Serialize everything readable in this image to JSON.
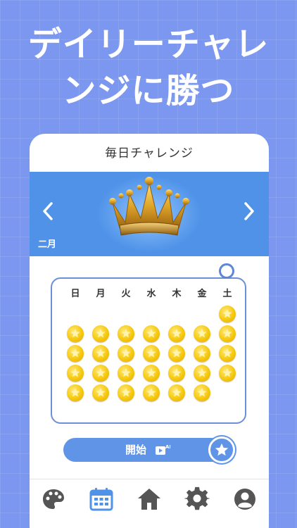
{
  "headline": {
    "line1": "デイリーチャレ",
    "line2": "ンジに勝つ"
  },
  "card": {
    "title": "毎日チャレンジ",
    "month": "二月",
    "prev_icon": "chevron-left-icon",
    "next_icon": "chevron-right-icon",
    "banner_image": "crown-icon"
  },
  "calendar": {
    "weekdays": [
      "日",
      "月",
      "火",
      "水",
      "木",
      "金",
      "土"
    ],
    "completed_days": 28,
    "first_weekday_index": 6,
    "coin_icon": "star-coin-icon"
  },
  "start": {
    "label": "開始",
    "icon": "video-ad-icon",
    "badge_icon": "star-icon"
  },
  "tabs": [
    {
      "name": "palette",
      "icon": "palette-icon"
    },
    {
      "name": "calendar",
      "icon": "calendar-icon",
      "active": true
    },
    {
      "name": "home",
      "icon": "home-icon"
    },
    {
      "name": "settings",
      "icon": "gear-icon"
    },
    {
      "name": "profile",
      "icon": "user-icon"
    }
  ],
  "colors": {
    "background": "#7b97ef",
    "accent": "#4f92e8",
    "coin": "#f6c90e",
    "icon": "#555555"
  }
}
